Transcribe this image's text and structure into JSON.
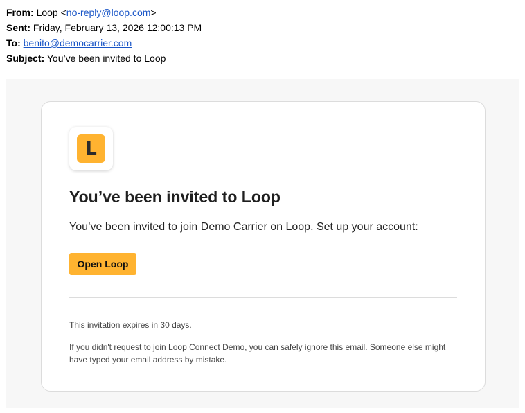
{
  "headers": {
    "from_label": "From:",
    "from_name": "Loop",
    "from_open": "<",
    "from_email": "no-reply@loop.com",
    "from_close": ">",
    "sent_label": "Sent:",
    "sent_value": "Friday, February 13, 2026 12:00:13 PM",
    "to_label": "To:",
    "to_email": "benito@democarrier.com",
    "subject_label": "Subject:",
    "subject_value": "You’ve been invited to Loop"
  },
  "email": {
    "logo_letter": "L",
    "logo_icon": "loop-logo-icon",
    "heading": "You’ve been invited to Loop",
    "body": "You’ve been invited to join Demo Carrier on Loop. Set up your account:",
    "cta_label": "Open Loop",
    "expiry": "This invitation expires in 30 days.",
    "ignore_note": "If you didn't request to join Loop Connect Demo, you can safely ignore this email. Someone else might have typed your email address by mistake."
  },
  "colors": {
    "accent": "#ffb330",
    "link": "#1a56c7",
    "outer_background": "#f7f7f7",
    "card_border": "#dcdcdc"
  }
}
